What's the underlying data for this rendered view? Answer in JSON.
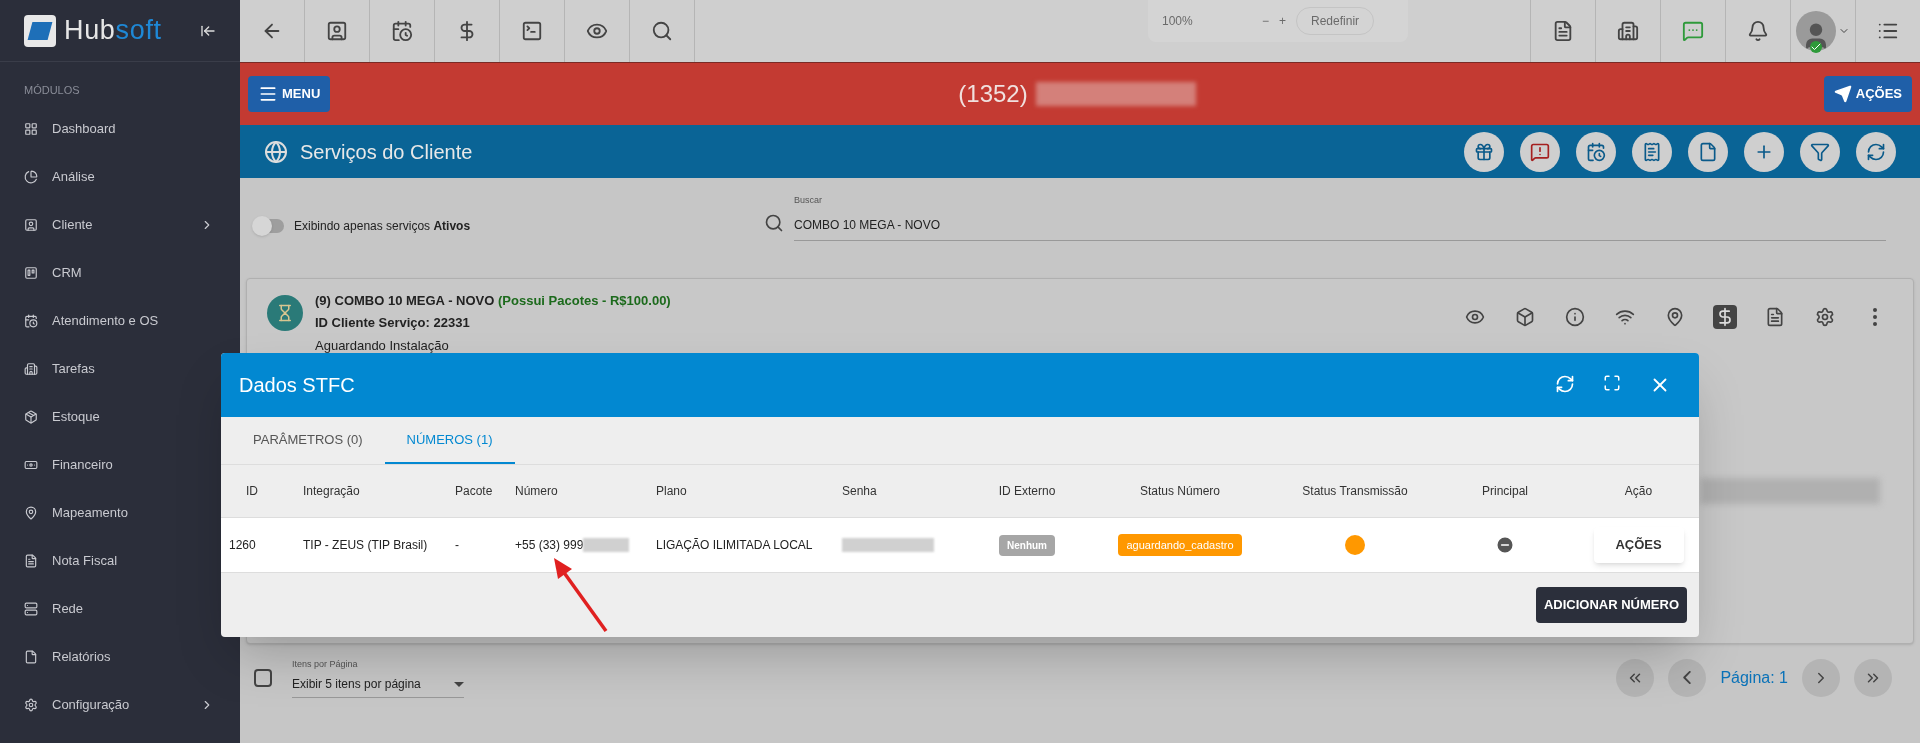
{
  "sidebar": {
    "logo_main": "Hub",
    "logo_accent": "soft",
    "section_label": "MÓDULOS",
    "items": [
      {
        "label": "Dashboard",
        "expandable": false
      },
      {
        "label": "Análise",
        "expandable": false
      },
      {
        "label": "Cliente",
        "expandable": true
      },
      {
        "label": "CRM",
        "expandable": false
      },
      {
        "label": "Atendimento e OS",
        "expandable": false
      },
      {
        "label": "Tarefas",
        "expandable": false
      },
      {
        "label": "Estoque",
        "expandable": false
      },
      {
        "label": "Financeiro",
        "expandable": false
      },
      {
        "label": "Mapeamento",
        "expandable": false
      },
      {
        "label": "Nota Fiscal",
        "expandable": false
      },
      {
        "label": "Rede",
        "expandable": false
      },
      {
        "label": "Relatórios",
        "expandable": false
      },
      {
        "label": "Configuração",
        "expandable": true
      }
    ]
  },
  "topbar": {
    "zoom_popup": {
      "value": "100%",
      "minus": "−",
      "plus": "+",
      "reset": "Redefinir"
    }
  },
  "client_bar": {
    "menu_button": "MENU",
    "client_id": "(1352)",
    "actions_button": "AÇÕES"
  },
  "page": {
    "title": "Serviços do Cliente"
  },
  "filter": {
    "toggle_on": false,
    "toggle_label": "Exibindo apenas serviços **Ativos**",
    "search_label": "Buscar",
    "search_value": "COMBO 10 MEGA - NOVO"
  },
  "service": {
    "title": "(9) COMBO 10 MEGA - NOVO",
    "package_note": "(Possui Pacotes - R$100.00)",
    "id_line": "ID Cliente Serviço: 22331",
    "status": "Aguardando Instalação"
  },
  "modal": {
    "title": "Dados STFC",
    "tabs": [
      {
        "label": "PARÂMETROS (0)",
        "selected": false
      },
      {
        "label": "NÚMEROS (1)",
        "selected": true
      }
    ],
    "columns": [
      "ID",
      "Integração",
      "Pacote",
      "Número",
      "Plano",
      "Senha",
      "ID Externo",
      "Status Número",
      "Status Transmissão",
      "Principal",
      "Ação"
    ],
    "rows": [
      {
        "id": "1260",
        "integracao": "TIP - ZEUS (TIP Brasil)",
        "pacote": "-",
        "numero": "+55 (33) 999",
        "plano": "LIGAÇÃO ILIMITADA LOCAL",
        "id_externo": "Nenhum",
        "status_numero": "aguardando_cadastro",
        "color": "#ff9800",
        "action": "AÇÕES"
      }
    ],
    "add_button": "ADICIONAR NÚMERO"
  },
  "pagination": {
    "select_all_checked": false,
    "per_page_label": "Itens por Página",
    "per_page_value": "Exibir 5 itens por página",
    "page_label": "Página: 1"
  }
}
